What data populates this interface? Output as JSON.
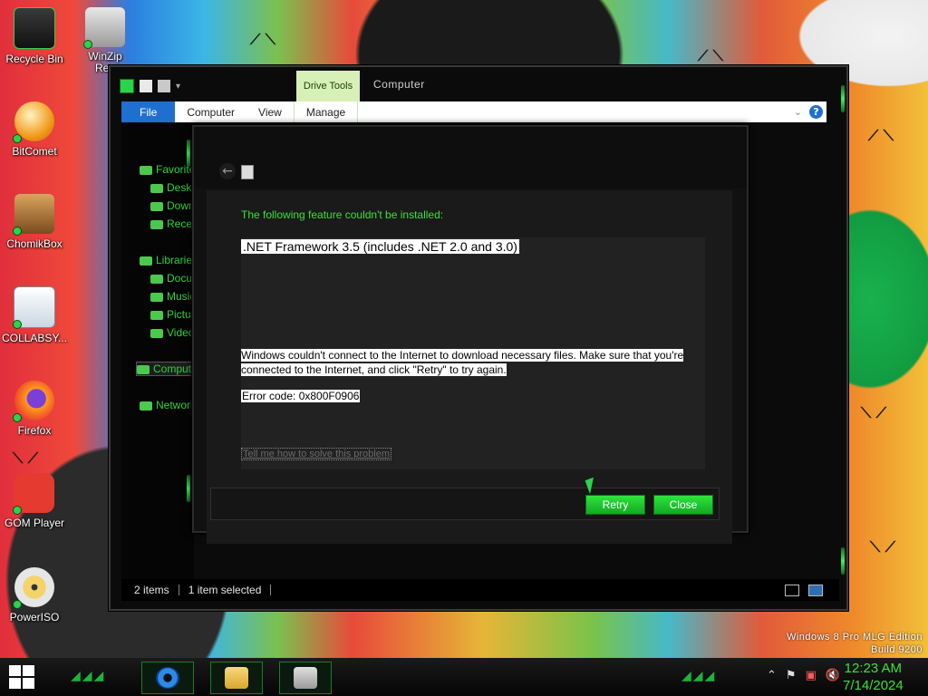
{
  "desktop": {
    "icons": [
      {
        "label": "Recycle Bin",
        "icon": "recycle-bin-icon"
      },
      {
        "label": "WinZip\nReg",
        "icon": "winzip-icon"
      },
      {
        "label": "BitComet",
        "icon": "bitcomet-icon"
      },
      {
        "label": "ChomikBox",
        "icon": "chomikbox-icon"
      },
      {
        "label": "COLLABSY...",
        "icon": "collabsy-icon"
      },
      {
        "label": "Firefox",
        "icon": "firefox-icon"
      },
      {
        "label": "GOM Player",
        "icon": "gom-player-icon"
      },
      {
        "label": "PowerISO",
        "icon": "poweriso-icon"
      }
    ],
    "edition_text": {
      "line1": "Windows 8 Pro MLG Edition",
      "line2": "Build 9200"
    }
  },
  "explorer": {
    "contextual_tab": "Drive Tools",
    "title": "Computer",
    "ribbon_tabs": {
      "file": "File",
      "computer": "Computer",
      "view": "View",
      "manage": "Manage"
    },
    "nav": {
      "favorites": "Favorites",
      "desktop": "Desktop",
      "downloads": "Downloads",
      "recent": "Recent places",
      "libraries": "Libraries",
      "documents": "Documents",
      "music": "Music",
      "pictures": "Pictures",
      "videos": "Videos",
      "computer": "Computer",
      "network": "Network"
    },
    "status": {
      "items": "2 items",
      "selected": "1 item selected"
    }
  },
  "dialog": {
    "heading": "The following feature couldn't be installed:",
    "feature": ".NET Framework 3.5 (includes .NET 2.0 and 3.0)",
    "message": "Windows couldn't connect to the Internet to download necessary files. Make sure that you're connected to the Internet, and click \"Retry\" to try again.",
    "error_code": "Error code: 0x800F0906",
    "help_link": "Tell me how to solve this problem",
    "buttons": {
      "retry": "Retry",
      "close": "Close"
    }
  },
  "taskbar": {
    "clock_time": "12:23 AM",
    "clock_date": "7/14/2024",
    "pinned": [
      "internet-explorer-icon",
      "file-explorer-icon",
      "control-panel-icon"
    ]
  },
  "colors": {
    "accent_green": "#2dd24c",
    "ribbon_blue": "#1f6fd1"
  }
}
